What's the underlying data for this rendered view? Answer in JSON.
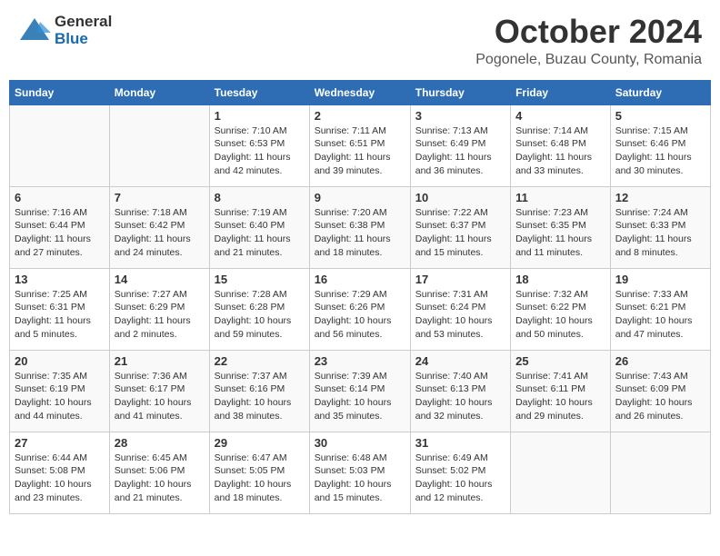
{
  "header": {
    "logo_general": "General",
    "logo_blue": "Blue",
    "month_title": "October 2024",
    "location": "Pogonele, Buzau County, Romania"
  },
  "weekdays": [
    "Sunday",
    "Monday",
    "Tuesday",
    "Wednesday",
    "Thursday",
    "Friday",
    "Saturday"
  ],
  "weeks": [
    [
      {
        "day": "",
        "info": ""
      },
      {
        "day": "",
        "info": ""
      },
      {
        "day": "1",
        "info": "Sunrise: 7:10 AM\nSunset: 6:53 PM\nDaylight: 11 hours and 42 minutes."
      },
      {
        "day": "2",
        "info": "Sunrise: 7:11 AM\nSunset: 6:51 PM\nDaylight: 11 hours and 39 minutes."
      },
      {
        "day": "3",
        "info": "Sunrise: 7:13 AM\nSunset: 6:49 PM\nDaylight: 11 hours and 36 minutes."
      },
      {
        "day": "4",
        "info": "Sunrise: 7:14 AM\nSunset: 6:48 PM\nDaylight: 11 hours and 33 minutes."
      },
      {
        "day": "5",
        "info": "Sunrise: 7:15 AM\nSunset: 6:46 PM\nDaylight: 11 hours and 30 minutes."
      }
    ],
    [
      {
        "day": "6",
        "info": "Sunrise: 7:16 AM\nSunset: 6:44 PM\nDaylight: 11 hours and 27 minutes."
      },
      {
        "day": "7",
        "info": "Sunrise: 7:18 AM\nSunset: 6:42 PM\nDaylight: 11 hours and 24 minutes."
      },
      {
        "day": "8",
        "info": "Sunrise: 7:19 AM\nSunset: 6:40 PM\nDaylight: 11 hours and 21 minutes."
      },
      {
        "day": "9",
        "info": "Sunrise: 7:20 AM\nSunset: 6:38 PM\nDaylight: 11 hours and 18 minutes."
      },
      {
        "day": "10",
        "info": "Sunrise: 7:22 AM\nSunset: 6:37 PM\nDaylight: 11 hours and 15 minutes."
      },
      {
        "day": "11",
        "info": "Sunrise: 7:23 AM\nSunset: 6:35 PM\nDaylight: 11 hours and 11 minutes."
      },
      {
        "day": "12",
        "info": "Sunrise: 7:24 AM\nSunset: 6:33 PM\nDaylight: 11 hours and 8 minutes."
      }
    ],
    [
      {
        "day": "13",
        "info": "Sunrise: 7:25 AM\nSunset: 6:31 PM\nDaylight: 11 hours and 5 minutes."
      },
      {
        "day": "14",
        "info": "Sunrise: 7:27 AM\nSunset: 6:29 PM\nDaylight: 11 hours and 2 minutes."
      },
      {
        "day": "15",
        "info": "Sunrise: 7:28 AM\nSunset: 6:28 PM\nDaylight: 10 hours and 59 minutes."
      },
      {
        "day": "16",
        "info": "Sunrise: 7:29 AM\nSunset: 6:26 PM\nDaylight: 10 hours and 56 minutes."
      },
      {
        "day": "17",
        "info": "Sunrise: 7:31 AM\nSunset: 6:24 PM\nDaylight: 10 hours and 53 minutes."
      },
      {
        "day": "18",
        "info": "Sunrise: 7:32 AM\nSunset: 6:22 PM\nDaylight: 10 hours and 50 minutes."
      },
      {
        "day": "19",
        "info": "Sunrise: 7:33 AM\nSunset: 6:21 PM\nDaylight: 10 hours and 47 minutes."
      }
    ],
    [
      {
        "day": "20",
        "info": "Sunrise: 7:35 AM\nSunset: 6:19 PM\nDaylight: 10 hours and 44 minutes."
      },
      {
        "day": "21",
        "info": "Sunrise: 7:36 AM\nSunset: 6:17 PM\nDaylight: 10 hours and 41 minutes."
      },
      {
        "day": "22",
        "info": "Sunrise: 7:37 AM\nSunset: 6:16 PM\nDaylight: 10 hours and 38 minutes."
      },
      {
        "day": "23",
        "info": "Sunrise: 7:39 AM\nSunset: 6:14 PM\nDaylight: 10 hours and 35 minutes."
      },
      {
        "day": "24",
        "info": "Sunrise: 7:40 AM\nSunset: 6:13 PM\nDaylight: 10 hours and 32 minutes."
      },
      {
        "day": "25",
        "info": "Sunrise: 7:41 AM\nSunset: 6:11 PM\nDaylight: 10 hours and 29 minutes."
      },
      {
        "day": "26",
        "info": "Sunrise: 7:43 AM\nSunset: 6:09 PM\nDaylight: 10 hours and 26 minutes."
      }
    ],
    [
      {
        "day": "27",
        "info": "Sunrise: 6:44 AM\nSunset: 5:08 PM\nDaylight: 10 hours and 23 minutes."
      },
      {
        "day": "28",
        "info": "Sunrise: 6:45 AM\nSunset: 5:06 PM\nDaylight: 10 hours and 21 minutes."
      },
      {
        "day": "29",
        "info": "Sunrise: 6:47 AM\nSunset: 5:05 PM\nDaylight: 10 hours and 18 minutes."
      },
      {
        "day": "30",
        "info": "Sunrise: 6:48 AM\nSunset: 5:03 PM\nDaylight: 10 hours and 15 minutes."
      },
      {
        "day": "31",
        "info": "Sunrise: 6:49 AM\nSunset: 5:02 PM\nDaylight: 10 hours and 12 minutes."
      },
      {
        "day": "",
        "info": ""
      },
      {
        "day": "",
        "info": ""
      }
    ]
  ]
}
